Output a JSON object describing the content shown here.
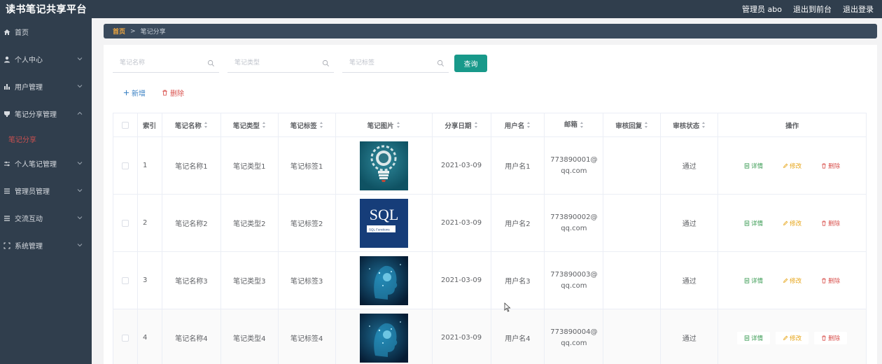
{
  "app": {
    "title": "读书笔记共享平台",
    "admin_label": "管理员 abo",
    "to_front_label": "退出到前台",
    "logout_label": "退出登录"
  },
  "sidebar": {
    "items": [
      {
        "label": "首页",
        "icon": "home-icon",
        "has_chevron": false
      },
      {
        "label": "个人中心",
        "icon": "user-icon",
        "has_chevron": true
      },
      {
        "label": "用户管理",
        "icon": "bar-chart-icon",
        "has_chevron": true
      },
      {
        "label": "笔记分享管理",
        "icon": "trophy-icon",
        "has_chevron": true,
        "expanded": true
      },
      {
        "label": "个人笔记管理",
        "icon": "sliders-icon",
        "has_chevron": true
      },
      {
        "label": "管理员管理",
        "icon": "list-icon",
        "has_chevron": true
      },
      {
        "label": "交流互动",
        "icon": "list-icon",
        "has_chevron": true
      },
      {
        "label": "系统管理",
        "icon": "frame-icon",
        "has_chevron": true
      }
    ],
    "active_sub": "笔记分享"
  },
  "breadcrumb": {
    "home": "首页",
    "separator": ">",
    "current": "笔记分享"
  },
  "search": {
    "name_placeholder": "笔记名称",
    "type_placeholder": "笔记类型",
    "tag_placeholder": "笔记标签",
    "query_label": "查询"
  },
  "actions": {
    "add_label": "新增",
    "delete_label": "删除"
  },
  "table": {
    "headers": {
      "index": "索引",
      "name": "笔记名称",
      "type": "笔记类型",
      "tag": "笔记标签",
      "image": "笔记图片",
      "date": "分享日期",
      "user": "用户名",
      "email": "邮箱",
      "reply": "审核回复",
      "status": "审核状态",
      "ops": "操作"
    },
    "op_labels": {
      "detail": "详情",
      "edit": "修改",
      "remove": "删除"
    },
    "rows": [
      {
        "index": "1",
        "name": "笔记名称1",
        "type": "笔记类型1",
        "tag": "笔记标签1",
        "image": "lightbulb-gears-thumbnail",
        "date": "2021-03-09",
        "user": "用户名1",
        "email_line1": "773890001@",
        "email_line2": "qq.com",
        "reply": "",
        "status": "通过"
      },
      {
        "index": "2",
        "name": "笔记名称2",
        "type": "笔记类型2",
        "tag": "笔记标签2",
        "image": "sql-functions-thumbnail",
        "sql_text": "SQL",
        "sql_sub": "SQL Functions",
        "date": "2021-03-09",
        "user": "用户名2",
        "email_line1": "773890002@",
        "email_line2": "qq.com",
        "reply": "",
        "status": "通过"
      },
      {
        "index": "3",
        "name": "笔记名称3",
        "type": "笔记类型3",
        "tag": "笔记标签3",
        "image": "ai-head-thumbnail",
        "date": "2021-03-09",
        "user": "用户名3",
        "email_line1": "773890003@",
        "email_line2": "qq.com",
        "reply": "",
        "status": "通过"
      },
      {
        "index": "4",
        "name": "笔记名称4",
        "type": "笔记类型4",
        "tag": "笔记标签4",
        "image": "ai-head-thumbnail",
        "date": "2021-03-09",
        "user": "用户名4",
        "email_line1": "773890004@",
        "email_line2": "qq.com",
        "reply": "",
        "status": "通过"
      }
    ]
  },
  "colors": {
    "sidebar_bg": "#303e4d",
    "accent": "#18998a",
    "active_sub": "#c95050",
    "breadcrumb_home": "#f4a93e"
  }
}
